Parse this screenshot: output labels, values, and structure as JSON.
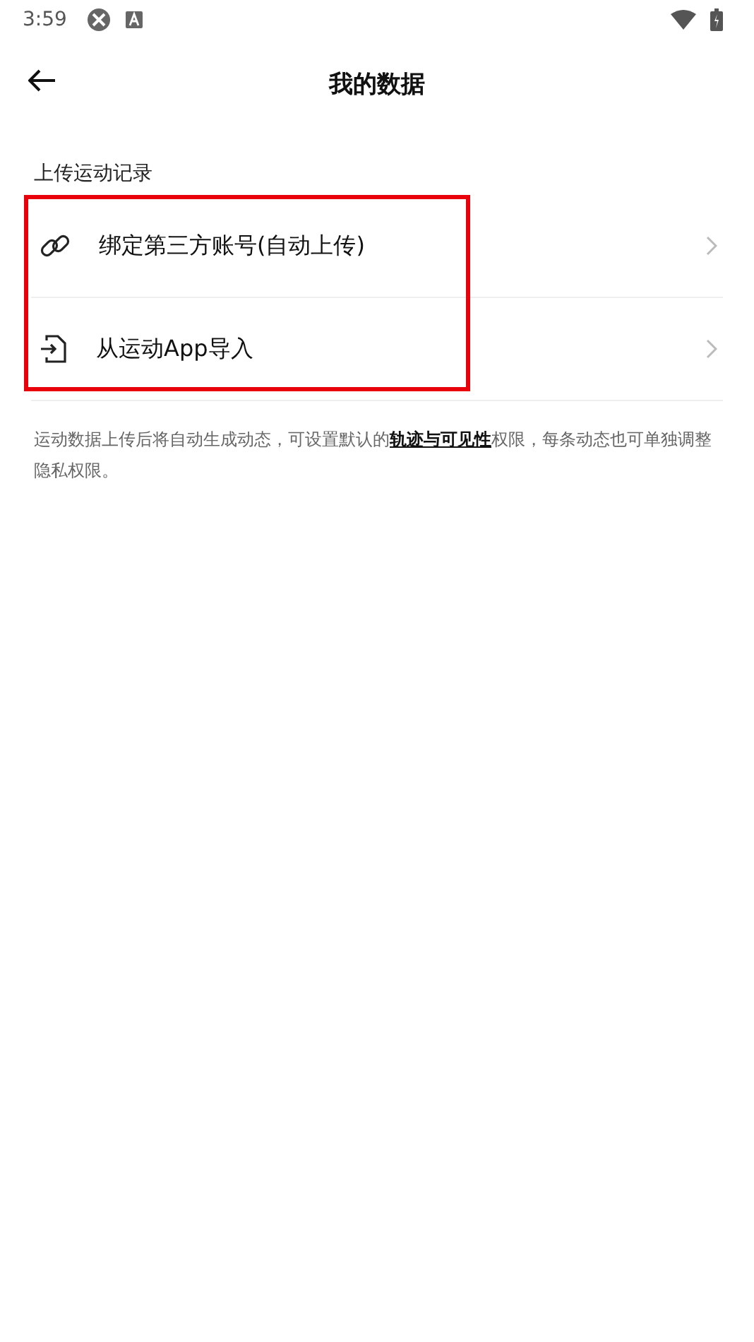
{
  "status_bar": {
    "time": "3:59"
  },
  "header": {
    "title": "我的数据"
  },
  "section": {
    "label": "上传运动记录"
  },
  "items": [
    {
      "kind": "link",
      "label": "绑定第三方账号(自动上传)"
    },
    {
      "kind": "import",
      "label": "从运动App导入"
    }
  ],
  "note": {
    "before": "运动数据上传后将自动生成动态，可设置默认的",
    "link": "轨迹与可见性",
    "after": "权限，每条动态也可单独调整隐私权限。"
  }
}
